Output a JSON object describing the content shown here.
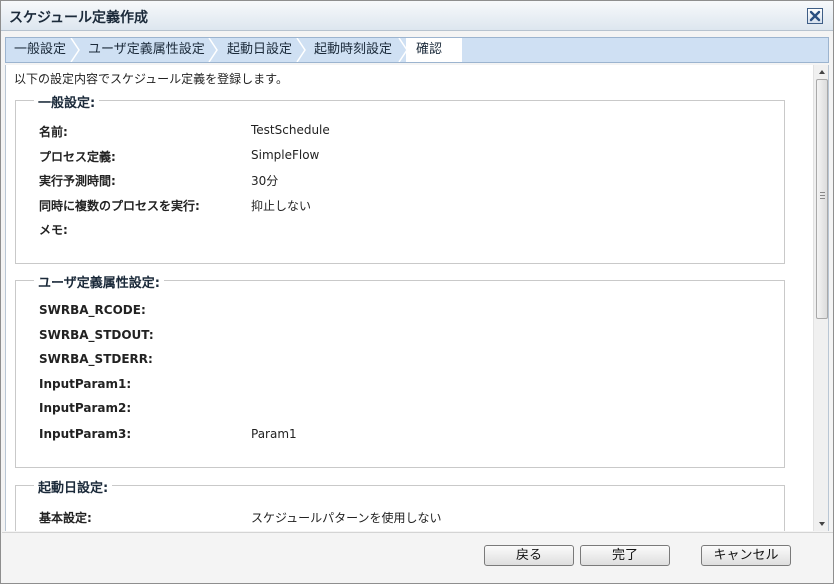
{
  "window": {
    "title": "スケジュール定義作成"
  },
  "steps": [
    {
      "label": "一般設定"
    },
    {
      "label": "ユーザ定義属性設定"
    },
    {
      "label": "起動日設定"
    },
    {
      "label": "起動時刻設定"
    },
    {
      "label": "確認",
      "current": true
    }
  ],
  "intro": "以下の設定内容でスケジュール定義を登録します。",
  "sections": {
    "general": {
      "title": "一般設定:",
      "rows": [
        {
          "label": "名前:",
          "value": "TestSchedule"
        },
        {
          "label": "プロセス定義:",
          "value": "SimpleFlow"
        },
        {
          "label": "実行予測時間:",
          "value": "30分"
        },
        {
          "label": "同時に複数のプロセスを実行:",
          "value": "抑止しない"
        },
        {
          "label": "メモ:",
          "value": ""
        }
      ]
    },
    "user_attrs": {
      "title": "ユーザ定義属性設定:",
      "rows": [
        {
          "label": "SWRBA_RCODE:",
          "value": ""
        },
        {
          "label": "SWRBA_STDOUT:",
          "value": ""
        },
        {
          "label": "SWRBA_STDERR:",
          "value": ""
        },
        {
          "label": "InputParam1:",
          "value": ""
        },
        {
          "label": "InputParam2:",
          "value": ""
        },
        {
          "label": "InputParam3:",
          "value": "Param1"
        }
      ]
    },
    "start_date": {
      "title": "起動日設定:",
      "rows": [
        {
          "label": "基本設定:",
          "value": "スケジュールパターンを使用しない"
        }
      ]
    }
  },
  "buttons": {
    "back": "戻る",
    "finish": "完了",
    "cancel": "キャンセル"
  },
  "icons": {
    "close": "close-icon",
    "scroll_up": "arrow-up-icon",
    "scroll_down": "arrow-down-icon"
  },
  "colors": {
    "title_bar": "#dde6ef",
    "steps_bar": "#cfe0f3",
    "close_x": "#2b4f80"
  }
}
